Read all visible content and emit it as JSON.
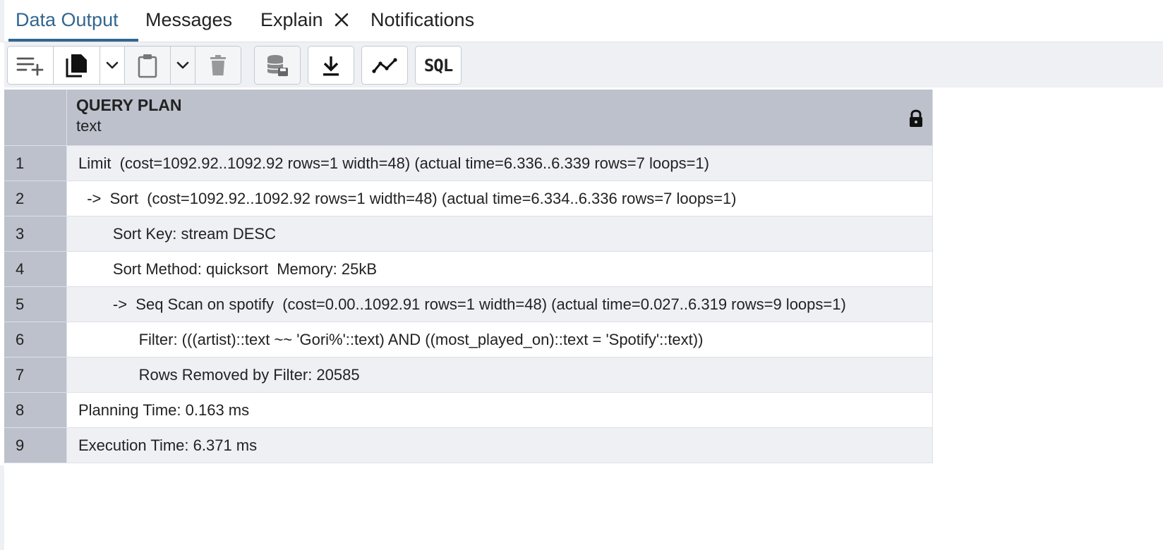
{
  "tabs": [
    {
      "label": "Data Output",
      "active": true
    },
    {
      "label": "Messages",
      "active": false
    },
    {
      "label": "Explain",
      "active": false,
      "closable": true
    },
    {
      "label": "Notifications",
      "active": false
    }
  ],
  "toolbar": {
    "buttons": [
      "add-row-icon",
      "copy-icon",
      "chevron-down-icon",
      "paste-icon",
      "chevron-down-icon",
      "delete-icon",
      "save-data-icon",
      "download-icon",
      "graph-icon",
      "sql-icon"
    ],
    "sql_label": "SQL"
  },
  "grid": {
    "column": {
      "title": "QUERY PLAN",
      "type": "text",
      "locked": true
    },
    "rows": [
      {
        "n": "1",
        "text": "Limit  (cost=1092.92..1092.92 rows=1 width=48) (actual time=6.336..6.339 rows=7 loops=1)"
      },
      {
        "n": "2",
        "text": "  ->  Sort  (cost=1092.92..1092.92 rows=1 width=48) (actual time=6.334..6.336 rows=7 loops=1)"
      },
      {
        "n": "3",
        "text": "        Sort Key: stream DESC"
      },
      {
        "n": "4",
        "text": "        Sort Method: quicksort  Memory: 25kB"
      },
      {
        "n": "5",
        "text": "        ->  Seq Scan on spotify  (cost=0.00..1092.91 rows=1 width=48) (actual time=0.027..6.319 rows=9 loops=1)"
      },
      {
        "n": "6",
        "text": "              Filter: (((artist)::text ~~ 'Gori%'::text) AND ((most_played_on)::text = 'Spotify'::text))"
      },
      {
        "n": "7",
        "text": "              Rows Removed by Filter: 20585"
      },
      {
        "n": "8",
        "text": "Planning Time: 0.163 ms"
      },
      {
        "n": "9",
        "text": "Execution Time: 6.371 ms"
      }
    ]
  },
  "colors": {
    "accent": "#326690",
    "header_bg": "#bcc1cc",
    "toolbar_bg": "#eef0f4",
    "row_alt": "#eef0f4"
  }
}
